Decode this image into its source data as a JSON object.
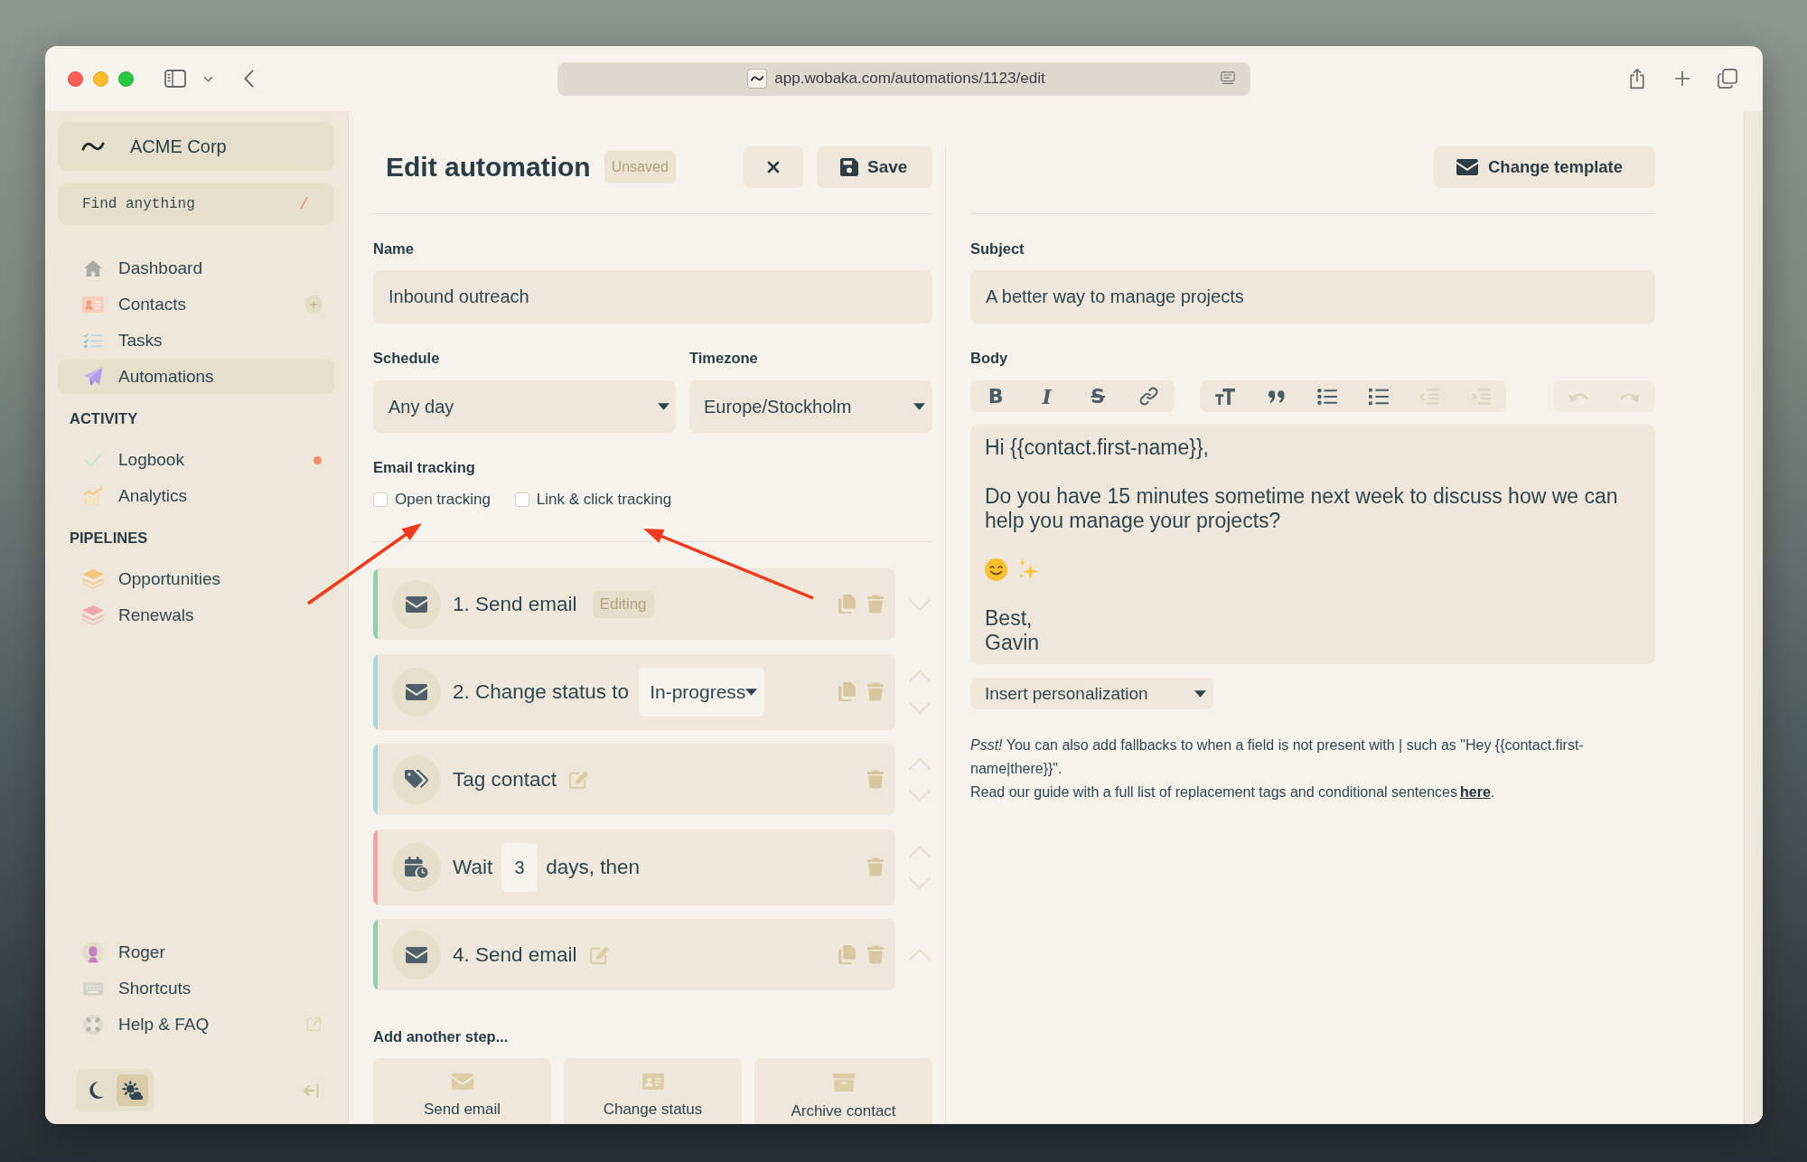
{
  "browser": {
    "url": "app.wobaka.com/automations/1123/edit"
  },
  "sidebar": {
    "workspace": "ACME Corp",
    "search": {
      "placeholder": "Find anything",
      "shortcut": "/"
    },
    "sections": [
      {
        "items": [
          {
            "kind": "home",
            "label": "Dashboard",
            "selected": false,
            "addable": false,
            "unread": false
          },
          {
            "kind": "contacts",
            "label": "Contacts",
            "selected": false,
            "addable": true,
            "unread": false
          },
          {
            "kind": "tasks",
            "label": "Tasks",
            "selected": false,
            "addable": false,
            "unread": false
          },
          {
            "kind": "automations",
            "label": "Automations",
            "selected": true,
            "addable": false,
            "unread": false
          }
        ]
      },
      {
        "heading": "ACTIVITY",
        "items": [
          {
            "kind": "logbook",
            "label": "Logbook",
            "selected": false,
            "addable": false,
            "unread": true
          },
          {
            "kind": "analytics",
            "label": "Analytics",
            "selected": false,
            "addable": false,
            "unread": false
          }
        ]
      },
      {
        "heading": "PIPELINES",
        "items": [
          {
            "kind": "opportunities",
            "label": "Opportunities",
            "selected": false,
            "addable": false,
            "unread": false
          },
          {
            "kind": "renewals",
            "label": "Renewals",
            "selected": false,
            "addable": false,
            "unread": false
          }
        ]
      }
    ],
    "footer_items": [
      {
        "kind": "user",
        "label": "Roger",
        "selected": false,
        "external": false
      },
      {
        "kind": "shortcuts",
        "label": "Shortcuts",
        "selected": false,
        "external": false
      },
      {
        "kind": "help",
        "label": "Help & FAQ",
        "selected": false,
        "external": true
      }
    ],
    "theme_switch": [
      {
        "kind": "dark",
        "selected": false
      },
      {
        "kind": "auto",
        "selected": true
      }
    ]
  },
  "editor": {
    "title": "Edit automation",
    "status": "Unsaved",
    "save": "Save",
    "name": {
      "label": "Name",
      "value": "Inbound outreach"
    },
    "schedule": {
      "label": "Schedule",
      "value": "Any day"
    },
    "timezone": {
      "label": "Timezone",
      "value": "Europe/Stockholm"
    },
    "tracking": {
      "label": "Email tracking",
      "options": [
        {
          "label": "Open tracking",
          "checked": false
        },
        {
          "label": "Link & click tracking",
          "checked": false
        }
      ]
    },
    "steps": [
      {
        "kind": "send_email",
        "title": "1. Send email",
        "badge": "Editing",
        "editable": false,
        "duplicable": true,
        "move_up": false,
        "move_down": true,
        "color": "#93d0a9"
      },
      {
        "kind": "change_status",
        "title": "2. Change status to",
        "select": "In-progress",
        "editable": false,
        "duplicable": true,
        "move_up": true,
        "move_down": true,
        "color": "#acd6e2"
      },
      {
        "kind": "tag",
        "title": "Tag contact",
        "editable": true,
        "duplicable": false,
        "move_up": true,
        "move_down": true,
        "color": "#acd6e2"
      },
      {
        "kind": "wait",
        "title": "Wait",
        "value": "3",
        "suffix": "days, then",
        "editable": false,
        "duplicable": false,
        "move_up": true,
        "move_down": true,
        "color": "#f2a7a7"
      },
      {
        "kind": "send_email",
        "title": "4. Send email",
        "editable": true,
        "duplicable": true,
        "move_up": true,
        "move_down": false,
        "color": "#93d0a9"
      }
    ],
    "add_step": {
      "label": "Add another step...",
      "options": [
        {
          "kind": "send_email",
          "label": "Send email"
        },
        {
          "kind": "change_status",
          "label": "Change status"
        },
        {
          "kind": "archive",
          "label": "Archive contact"
        }
      ]
    }
  },
  "email": {
    "change_template": "Change template",
    "subject": {
      "label": "Subject",
      "value": "A better way to manage projects"
    },
    "body": {
      "label": "Body",
      "toolbar": [
        [
          {
            "kind": "bold",
            "glyph": "B",
            "disabled": false
          },
          {
            "kind": "italic",
            "glyph": "I",
            "disabled": false
          },
          {
            "kind": "strike",
            "glyph": "S",
            "disabled": false
          },
          {
            "kind": "link",
            "disabled": false
          }
        ],
        [
          {
            "kind": "heading",
            "disabled": false
          },
          {
            "kind": "quote",
            "disabled": false
          },
          {
            "kind": "bullet_list",
            "disabled": false
          },
          {
            "kind": "numbered_list",
            "disabled": false
          },
          {
            "kind": "outdent",
            "disabled": true
          },
          {
            "kind": "indent",
            "disabled": true
          }
        ],
        [
          {
            "kind": "undo",
            "disabled": true
          },
          {
            "kind": "redo",
            "disabled": true
          }
        ]
      ],
      "paragraphs": [
        {
          "kind": "text",
          "lines": [
            "Hi {{contact.first-name}},"
          ]
        },
        {
          "kind": "text",
          "lines": [
            "Do you have 15 minutes sometime next week to discuss how we can help you manage your projects?"
          ]
        },
        {
          "kind": "emoji",
          "emoji": [
            {
              "kind": "smile"
            },
            {
              "kind": "sparkles"
            }
          ]
        },
        {
          "kind": "text",
          "lines": [
            "Best,",
            "Gavin"
          ]
        }
      ]
    },
    "personalization": "Insert personalization",
    "hint": [
      {
        "text": "*Psst!* You can also add fallbacks to when a field is not present with | such as \"Hey {{contact.first-name|there}}\"."
      },
      {
        "text": "Read our guide with a full list of replacement tags and conditional sentences",
        "link": "here",
        "after": "."
      }
    ]
  }
}
